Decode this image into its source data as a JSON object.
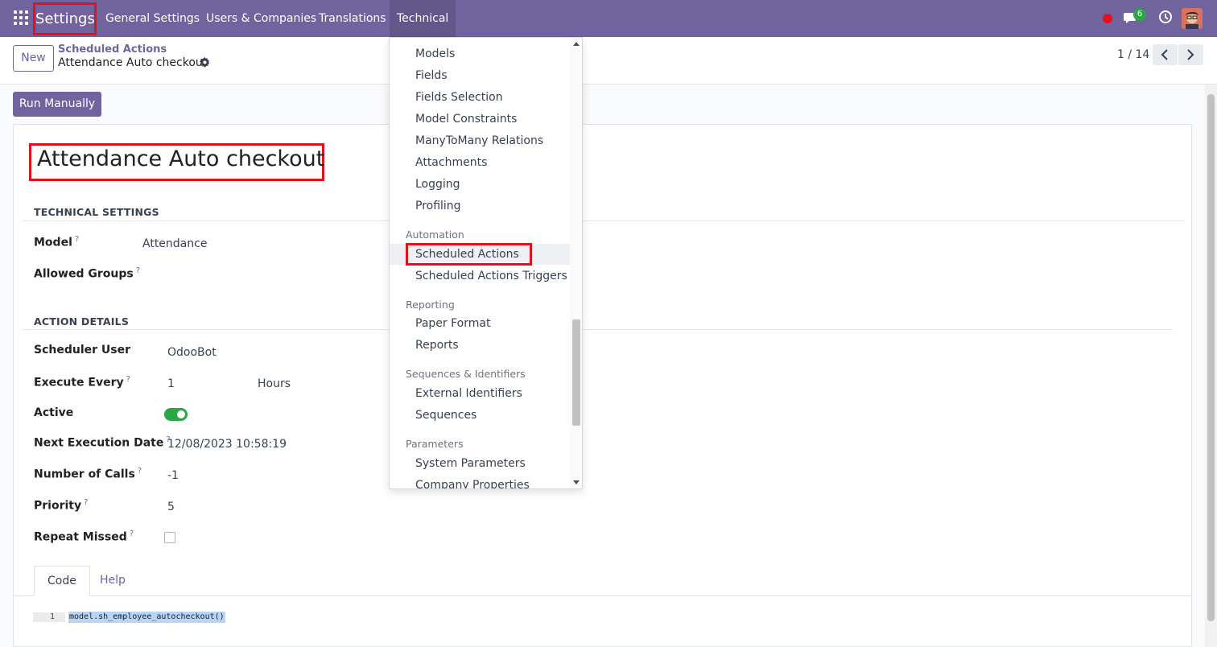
{
  "navbar": {
    "app_title": "Settings",
    "menu": [
      {
        "label": "General Settings"
      },
      {
        "label": "Users & Companies"
      },
      {
        "label": "Translations"
      },
      {
        "label": "Technical"
      }
    ],
    "chat_badge": "6",
    "brand_color": "#71639e"
  },
  "control_panel": {
    "new_label": "New",
    "breadcrumb_parent": "Scheduled Actions",
    "breadcrumb_current": "Attendance Auto checkout",
    "pager": "1 / 14"
  },
  "actions": {
    "run_manually_label": "Run Manually"
  },
  "record": {
    "title": "Attendance Auto checkout",
    "technical_section": "TECHNICAL SETTINGS",
    "action_section": "ACTION DETAILS",
    "fields": {
      "model": {
        "label": "Model",
        "value": "Attendance"
      },
      "allowed_groups": {
        "label": "Allowed Groups",
        "value": ""
      },
      "scheduler_user": {
        "label": "Scheduler User",
        "value": "OdooBot"
      },
      "execute_every": {
        "label": "Execute Every",
        "value": "1",
        "unit": "Hours"
      },
      "active": {
        "label": "Active",
        "value": true
      },
      "next_execution_date": {
        "label": "Next Execution Date",
        "value": "12/08/2023 10:58:19"
      },
      "number_of_calls": {
        "label": "Number of Calls",
        "value": "-1"
      },
      "priority": {
        "label": "Priority",
        "value": "5"
      },
      "repeat_missed": {
        "label": "Repeat Missed",
        "value": false
      }
    },
    "help_mark": "?",
    "tabs": [
      {
        "label": "Code",
        "active": true
      },
      {
        "label": "Help",
        "active": false
      }
    ],
    "code": {
      "line_number": "1",
      "text": "model.sh_employee_autocheckout()"
    }
  },
  "technical_menu": {
    "items_top": [
      "Models",
      "Fields",
      "Fields Selection",
      "Model Constraints",
      "ManyToMany Relations",
      "Attachments",
      "Logging",
      "Profiling"
    ],
    "automation_header": "Automation",
    "automation_items": [
      "Scheduled Actions",
      "Scheduled Actions Triggers"
    ],
    "reporting_header": "Reporting",
    "reporting_items": [
      "Paper Format",
      "Reports"
    ],
    "sequences_header": "Sequences & Identifiers",
    "sequences_items": [
      "External Identifiers",
      "Sequences"
    ],
    "parameters_header": "Parameters",
    "parameters_items": [
      "System Parameters",
      "Company Properties"
    ]
  },
  "icons": {
    "apps": "apps-grid-icon",
    "record": "recording-dot-icon",
    "chat": "chat-icon",
    "activity": "clock-icon",
    "gear": "gear-icon"
  }
}
